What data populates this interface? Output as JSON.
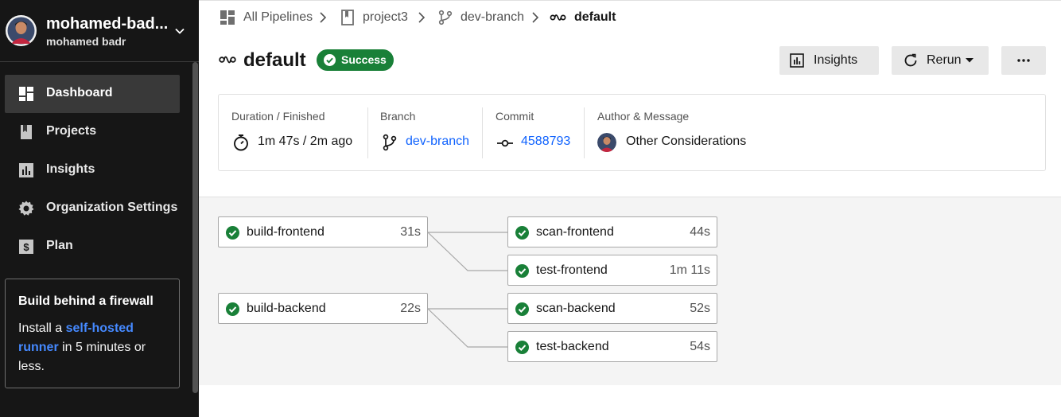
{
  "sidebar": {
    "org_name": "mohamed-bad...",
    "org_user": "mohamed badr",
    "items": [
      {
        "label": "Dashboard",
        "icon": "dashboard-icon",
        "active": true
      },
      {
        "label": "Projects",
        "icon": "projects-icon",
        "active": false
      },
      {
        "label": "Insights",
        "icon": "insights-icon",
        "active": false
      },
      {
        "label": "Organization Settings",
        "icon": "gear-icon",
        "active": false
      },
      {
        "label": "Plan",
        "icon": "dollar-icon",
        "active": false
      }
    ],
    "promo": {
      "title": "Build behind a firewall",
      "text_before": "Install a ",
      "link": "self-hosted runner",
      "text_after": " in 5 minutes or less."
    }
  },
  "breadcrumb": [
    {
      "label": "All Pipelines",
      "icon": "pipelines-icon"
    },
    {
      "label": "project3",
      "icon": "project-icon"
    },
    {
      "label": "dev-branch",
      "icon": "branch-icon"
    },
    {
      "label": "default",
      "icon": "workflow-icon"
    }
  ],
  "header": {
    "title": "default",
    "status": "Success",
    "insights_label": "Insights",
    "rerun_label": "Rerun"
  },
  "details": {
    "duration_label": "Duration / Finished",
    "duration_value": "1m 47s / 2m ago",
    "branch_label": "Branch",
    "branch_value": "dev-branch",
    "commit_label": "Commit",
    "commit_value": "4588793",
    "author_label": "Author & Message",
    "author_message": "Other Considerations"
  },
  "jobs": [
    {
      "name": "build-frontend",
      "duration": "31s",
      "status": "success"
    },
    {
      "name": "scan-frontend",
      "duration": "44s",
      "status": "success"
    },
    {
      "name": "test-frontend",
      "duration": "1m 11s",
      "status": "success"
    },
    {
      "name": "build-backend",
      "duration": "22s",
      "status": "success"
    },
    {
      "name": "scan-backend",
      "duration": "52s",
      "status": "success"
    },
    {
      "name": "test-backend",
      "duration": "54s",
      "status": "success"
    }
  ],
  "colors": {
    "sidebar_bg": "#161616",
    "success": "#198038",
    "link": "#0f62fe",
    "promo_link": "#4589ff"
  }
}
